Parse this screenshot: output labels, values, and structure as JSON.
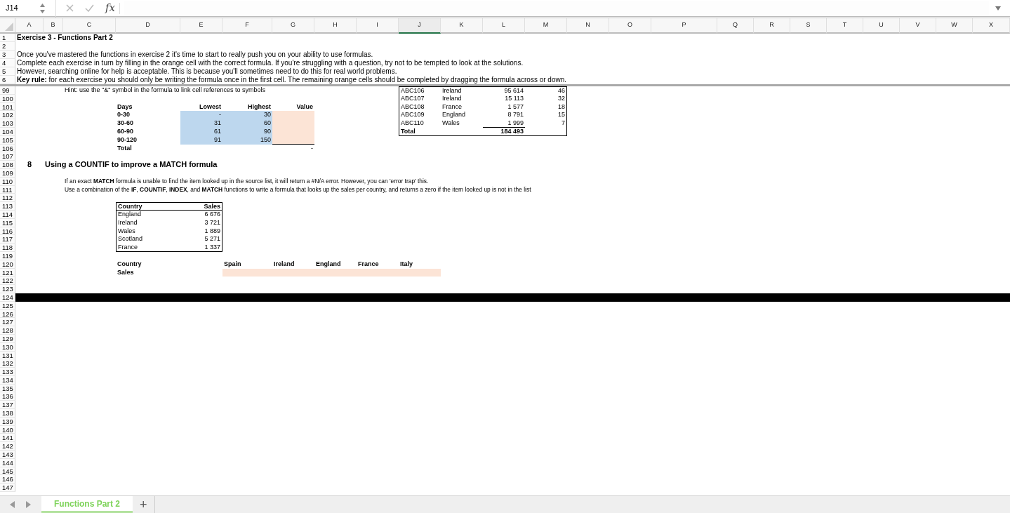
{
  "formula_bar": {
    "cell_reference": "J14",
    "function_label": "fx"
  },
  "columns": [
    {
      "label": "A",
      "selected": false
    },
    {
      "label": "B",
      "selected": false
    },
    {
      "label": "C",
      "selected": false
    },
    {
      "label": "D",
      "selected": false
    },
    {
      "label": "E",
      "selected": false
    },
    {
      "label": "F",
      "selected": false
    },
    {
      "label": "G",
      "selected": false
    },
    {
      "label": "H",
      "selected": false
    },
    {
      "label": "I",
      "selected": false
    },
    {
      "label": "J",
      "selected": true
    },
    {
      "label": "K",
      "selected": false
    },
    {
      "label": "L",
      "selected": false
    },
    {
      "label": "M",
      "selected": false
    },
    {
      "label": "N",
      "selected": false
    },
    {
      "label": "O",
      "selected": false
    },
    {
      "label": "P",
      "selected": false
    },
    {
      "label": "Q",
      "selected": false
    },
    {
      "label": "R",
      "selected": false
    },
    {
      "label": "S",
      "selected": false
    },
    {
      "label": "T",
      "selected": false
    },
    {
      "label": "U",
      "selected": false
    },
    {
      "label": "V",
      "selected": false
    },
    {
      "label": "W",
      "selected": false
    },
    {
      "label": "X",
      "selected": false
    }
  ],
  "frozen_rows": [
    {
      "number": "1",
      "cells": {
        "A": {
          "text": "Exercise 3 - Functions Part 2",
          "kind": "text",
          "bold": true
        }
      }
    },
    {
      "number": "2"
    },
    {
      "number": "3",
      "cells": {
        "A": {
          "text": "Once you've mastered the functions in exercise 2 it's time to start to really push you on your ability to use formulas.",
          "kind": "text",
          "bold": false
        }
      }
    },
    {
      "number": "4",
      "cells": {
        "A": {
          "text": "Complete each exercise in turn by filling in the orange cell with the correct formula. If you're struggling with a question, try not to be tempted to look at the solutions.",
          "kind": "text",
          "bold": false
        }
      }
    },
    {
      "number": "5",
      "cells": {
        "A": {
          "text": "However, searching online for help is acceptable. This is because you'll sometimes need to do this for real world problems.",
          "kind": "text",
          "bold": false
        }
      }
    },
    {
      "number": "6",
      "cells": {
        "A": {
          "text": "**Key rule:** for each exercise you should only be writing the formula once in the first cell.  The remaining orange cells should be completed by dragging the formula across or down.",
          "kind": "text",
          "bold": false
        }
      }
    }
  ],
  "rows": [
    {
      "number": "99",
      "cells": {
        "C": {
          "text": "Hint: use the \"&\" symbol in the formula to link cell references to symbols",
          "kind": "label",
          "bold": false
        },
        "J": {
          "text": "ABC106",
          "kind": "label",
          "bold": false,
          "border_top": true,
          "border_left": true
        },
        "K": {
          "text": "Ireland",
          "kind": "label",
          "bold": false,
          "border_top": true
        },
        "L": {
          "text": "95 614",
          "kind": "number",
          "bold": false,
          "border_top": true
        },
        "M": {
          "text": "46",
          "kind": "number",
          "bold": false,
          "border_top": true,
          "border_right": true
        }
      }
    },
    {
      "number": "100",
      "cells": {
        "J": {
          "text": "ABC107",
          "kind": "label",
          "bold": false,
          "border_left": true
        },
        "K": {
          "text": "Ireland",
          "kind": "label",
          "bold": false
        },
        "L": {
          "text": "15 113",
          "kind": "number",
          "bold": false
        },
        "M": {
          "text": "32",
          "kind": "number",
          "bold": false,
          "border_right": true
        }
      }
    },
    {
      "number": "101",
      "cells": {
        "D": {
          "text": "Days",
          "kind": "label",
          "bold": true
        },
        "E": {
          "text": "Lowest",
          "kind": "number",
          "bold": true
        },
        "F": {
          "text": "Highest",
          "kind": "number",
          "bold": true
        },
        "G": {
          "text": "Value",
          "kind": "number",
          "bold": true
        },
        "J": {
          "text": "ABC108",
          "kind": "label",
          "bold": false,
          "border_left": true
        },
        "K": {
          "text": "France",
          "kind": "label",
          "bold": false
        },
        "L": {
          "text": "1 577",
          "kind": "number",
          "bold": false
        },
        "M": {
          "text": "18",
          "kind": "number",
          "bold": false,
          "border_right": true
        }
      }
    },
    {
      "number": "102",
      "cells": {
        "D": {
          "text": "0-30",
          "kind": "label",
          "bold": true
        },
        "E": {
          "text": "-",
          "kind": "number",
          "bold": false,
          "color": "#bdd7ee"
        },
        "F": {
          "text": "30",
          "kind": "number",
          "bold": false,
          "color": "#bdd7ee"
        },
        "G": {
          "color": "#fce4d6"
        },
        "J": {
          "text": "ABC109",
          "kind": "label",
          "bold": false,
          "border_left": true
        },
        "K": {
          "text": "England",
          "kind": "label",
          "bold": false
        },
        "L": {
          "text": "8 791",
          "kind": "number",
          "bold": false
        },
        "M": {
          "text": "15",
          "kind": "number",
          "bold": false,
          "border_right": true
        }
      }
    },
    {
      "number": "103",
      "cells": {
        "D": {
          "text": "30-60",
          "kind": "label",
          "bold": true
        },
        "E": {
          "text": "31",
          "kind": "number",
          "bold": false,
          "color": "#bdd7ee"
        },
        "F": {
          "text": "60",
          "kind": "number",
          "bold": false,
          "color": "#bdd7ee"
        },
        "G": {
          "color": "#fce4d6"
        },
        "J": {
          "text": "ABC110",
          "kind": "label",
          "bold": false,
          "border_left": true
        },
        "K": {
          "text": "Wales",
          "kind": "label",
          "bold": false
        },
        "L": {
          "text": "1 999",
          "kind": "number",
          "bold": false,
          "border_bottom": true
        },
        "M": {
          "text": "7",
          "kind": "number",
          "bold": false,
          "border_right": true
        }
      }
    },
    {
      "number": "104",
      "cells": {
        "D": {
          "text": "60-90",
          "kind": "label",
          "bold": true
        },
        "E": {
          "text": "61",
          "kind": "number",
          "bold": false,
          "color": "#bdd7ee"
        },
        "F": {
          "text": "90",
          "kind": "number",
          "bold": false,
          "color": "#bdd7ee"
        },
        "G": {
          "color": "#fce4d6"
        },
        "J": {
          "text": "Total",
          "kind": "label",
          "bold": true,
          "border_left": true,
          "border_bottom": true
        },
        "K": {
          "border_bottom": true
        },
        "L": {
          "text": "184 493",
          "kind": "number",
          "bold": true,
          "border_bottom": true
        },
        "M": {
          "border_bottom": true,
          "border_right": true
        }
      }
    },
    {
      "number": "105",
      "cells": {
        "D": {
          "text": "90-120",
          "kind": "label",
          "bold": true
        },
        "E": {
          "text": "91",
          "kind": "number",
          "bold": false,
          "color": "#bdd7ee"
        },
        "F": {
          "text": "150",
          "kind": "number",
          "bold": false,
          "color": "#bdd7ee"
        },
        "G": {
          "color": "#fce4d6",
          "border_bottom": true
        }
      }
    },
    {
      "number": "106",
      "cells": {
        "D": {
          "text": "Total",
          "kind": "label",
          "bold": true
        },
        "G": {
          "text": "-",
          "kind": "number",
          "bold": false
        }
      }
    },
    {
      "number": "107"
    },
    {
      "number": "108",
      "cells": {
        "A": {
          "text": "8",
          "kind": "section",
          "bold": true
        },
        "B": {
          "text": "Using a COUNTIF to improve a MATCH formula",
          "kind": "heading",
          "bold": true
        }
      }
    },
    {
      "number": "109"
    },
    {
      "number": "110",
      "cells": {
        "C": {
          "text": "If an exact **MATCH** formula is unable to find the item looked up in the source list, it will return a #N/A error.  However, you can 'error trap' this.",
          "kind": "note",
          "bold": false
        }
      }
    },
    {
      "number": "111",
      "cells": {
        "C": {
          "text": "Use a combination of the **IF**, **COUNTIF**, **INDEX**, and **MATCH** functions to write a formula that looks up the sales per country, and returns a zero if the item looked up is not in the list",
          "kind": "note",
          "bold": false
        }
      }
    },
    {
      "number": "112"
    },
    {
      "number": "113",
      "cells": {
        "D": {
          "text": "Country",
          "kind": "label",
          "bold": true,
          "border_top": true,
          "border_left": true,
          "border_bottom": true
        },
        "E": {
          "text": "Sales",
          "kind": "number",
          "bold": true,
          "border_top": true,
          "border_right": true,
          "border_bottom": true
        }
      }
    },
    {
      "number": "114",
      "cells": {
        "D": {
          "text": "England",
          "kind": "label",
          "bold": false,
          "border_left": true
        },
        "E": {
          "text": "6 676",
          "kind": "number",
          "bold": false,
          "border_right": true
        }
      }
    },
    {
      "number": "115",
      "cells": {
        "D": {
          "text": "Ireland",
          "kind": "label",
          "bold": false,
          "border_left": true
        },
        "E": {
          "text": "3 721",
          "kind": "number",
          "bold": false,
          "border_right": true
        }
      }
    },
    {
      "number": "116",
      "cells": {
        "D": {
          "text": "Wales",
          "kind": "label",
          "bold": false,
          "border_left": true
        },
        "E": {
          "text": "1 889",
          "kind": "number",
          "bold": false,
          "border_right": true
        }
      }
    },
    {
      "number": "117",
      "cells": {
        "D": {
          "text": "Scotland",
          "kind": "label",
          "bold": false,
          "border_left": true
        },
        "E": {
          "text": "5 271",
          "kind": "number",
          "bold": false,
          "border_right": true
        }
      }
    },
    {
      "number": "118",
      "cells": {
        "D": {
          "text": "France",
          "kind": "label",
          "bold": false,
          "border_left": true,
          "border_bottom": true
        },
        "E": {
          "text": "1 337",
          "kind": "number",
          "bold": false,
          "border_right": true,
          "border_bottom": true
        }
      }
    },
    {
      "number": "119"
    },
    {
      "number": "120",
      "cells": {
        "D": {
          "text": "Country",
          "kind": "label",
          "bold": true
        },
        "F": {
          "text": "Spain",
          "kind": "label",
          "bold": true
        },
        "G": {
          "text": "Ireland",
          "kind": "label",
          "bold": true
        },
        "H": {
          "text": "England",
          "kind": "label",
          "bold": true
        },
        "I": {
          "text": "France",
          "kind": "label",
          "bold": true
        },
        "J": {
          "text": "Italy",
          "kind": "label",
          "bold": true
        }
      }
    },
    {
      "number": "121",
      "cells": {
        "D": {
          "text": "Sales",
          "kind": "label",
          "bold": true
        },
        "F": {
          "color": "#fce4d6"
        },
        "G": {
          "color": "#fce4d6"
        },
        "H": {
          "color": "#fce4d6"
        },
        "I": {
          "color": "#fce4d6"
        },
        "J": {
          "color": "#fce4d6"
        }
      }
    },
    {
      "number": "122"
    },
    {
      "number": "123"
    },
    {
      "number": "124",
      "band": true
    },
    {
      "number": "125"
    },
    {
      "number": "126"
    },
    {
      "number": "127"
    },
    {
      "number": "128"
    },
    {
      "number": "129"
    },
    {
      "number": "130"
    },
    {
      "number": "131"
    },
    {
      "number": "132"
    },
    {
      "number": "133"
    },
    {
      "number": "134"
    },
    {
      "number": "135"
    },
    {
      "number": "136"
    },
    {
      "number": "137"
    },
    {
      "number": "138"
    },
    {
      "number": "139"
    },
    {
      "number": "140"
    },
    {
      "number": "141"
    },
    {
      "number": "142"
    },
    {
      "number": "143"
    },
    {
      "number": "144"
    },
    {
      "number": "145"
    },
    {
      "number": "146"
    },
    {
      "number": "147"
    }
  ],
  "sheet_tabs": [
    {
      "label": "Functions Part 2",
      "selected": true
    }
  ],
  "add_sheet": "+"
}
